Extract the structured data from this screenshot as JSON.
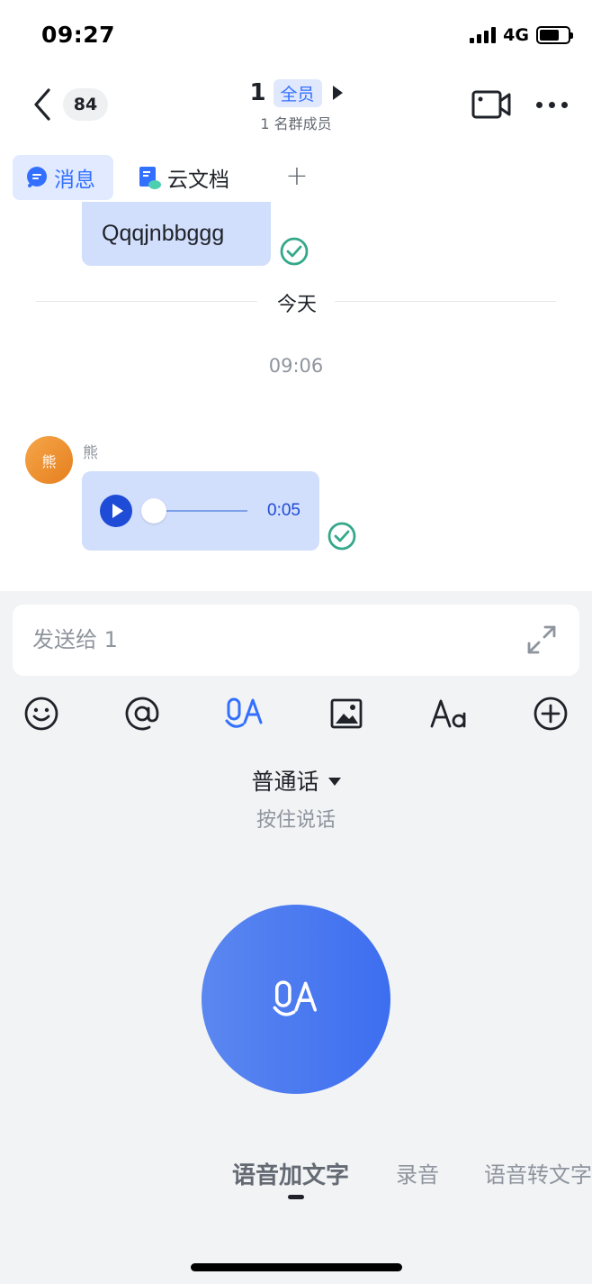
{
  "status_bar": {
    "time": "09:27",
    "network": "4G"
  },
  "header": {
    "unread_count": "84",
    "title": "1",
    "tag": "全员",
    "subtitle": "1 名群成员"
  },
  "tabs": [
    {
      "label": "消息",
      "icon": "chat-bubble-icon",
      "active": true
    },
    {
      "label": "云文档",
      "icon": "cloud-doc-icon",
      "active": false
    }
  ],
  "messages": {
    "text_message": "Qqqjnbbggg",
    "date_divider": "今天",
    "timestamp": "09:06",
    "voice_message": {
      "avatar_text": "熊",
      "sender": "熊",
      "duration": "0:05",
      "progress": 0
    }
  },
  "composer": {
    "placeholder": "发送给 1",
    "value": ""
  },
  "toolbar": [
    "emoji-icon",
    "at-mention-icon",
    "voice-input-icon",
    "image-icon",
    "text-format-icon",
    "add-more-icon"
  ],
  "voice_panel": {
    "language": "普通话",
    "hint": "按住说话",
    "modes": [
      {
        "label": "语音加文字",
        "active": true
      },
      {
        "label": "录音",
        "active": false
      },
      {
        "label": "语音转文字",
        "active": false
      }
    ]
  },
  "colors": {
    "accent": "#3370ff",
    "bubble": "#d1defc",
    "check": "#34a88a",
    "panel": "#f2f3f5"
  }
}
